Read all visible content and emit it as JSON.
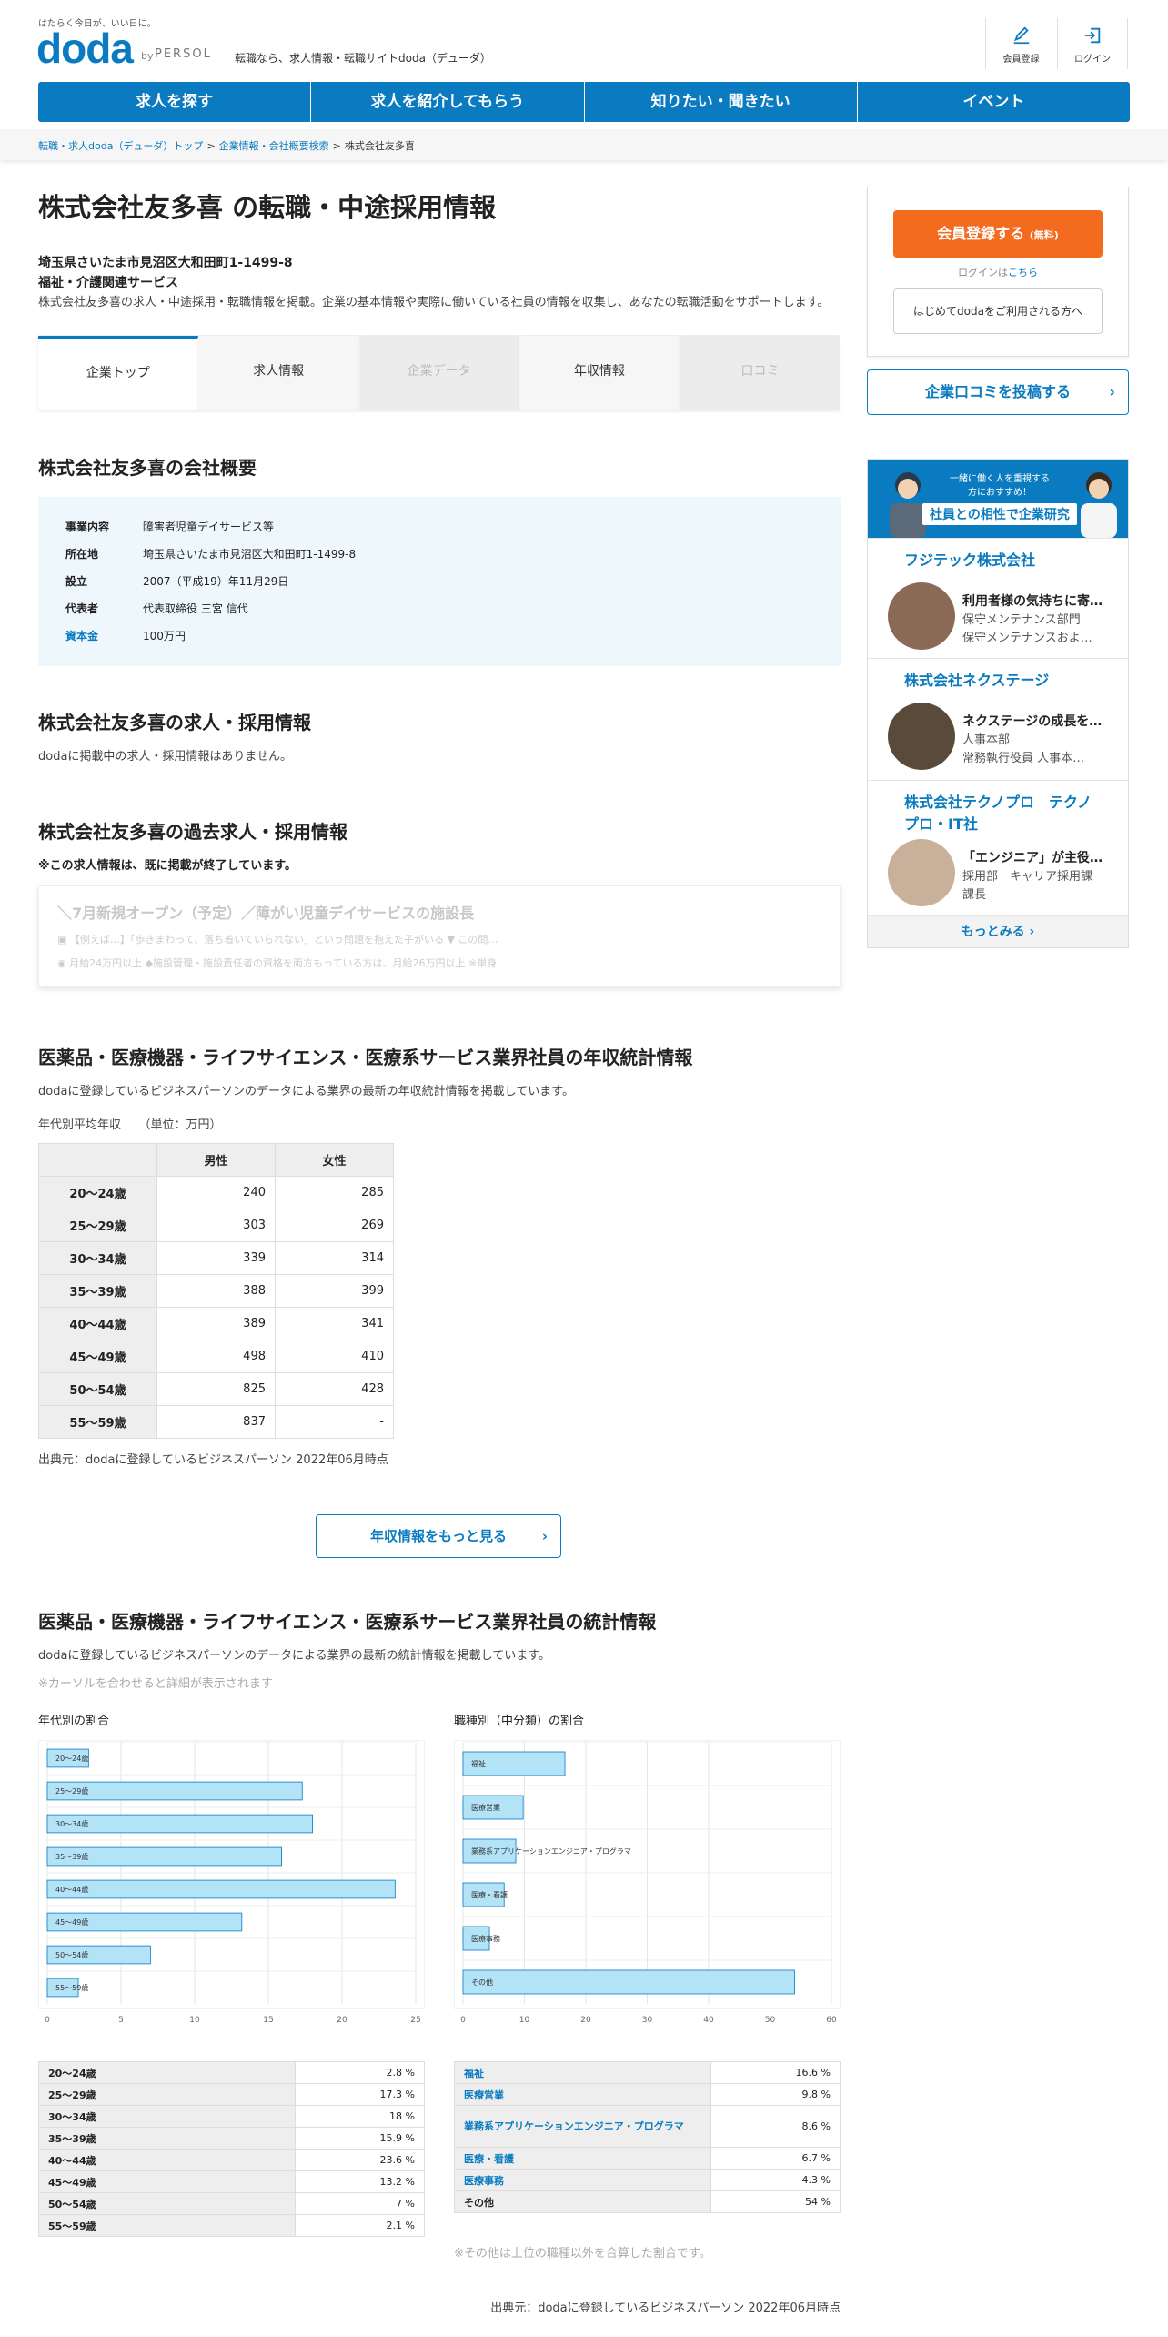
{
  "header": {
    "tagline": "はたらく今日が、いい日に。",
    "logo": "doda",
    "by": "by",
    "persol": "PERSOL",
    "description": "転職なら、求人情報・転職サイトdoda（デューダ）",
    "member_register": "会員登録",
    "login": "ログイン"
  },
  "nav": [
    "求人を探す",
    "求人を紹介してもらう",
    "知りたい・聞きたい",
    "イベント"
  ],
  "breadcrumb": {
    "items": [
      "転職・求人doda（デューダ）トップ",
      "企業情報・会社概要検索"
    ],
    "current": "株式会社友多喜"
  },
  "company": {
    "title": "株式会社友多喜 の転職・中途採用情報",
    "address": "埼玉県さいたま市見沼区大和田町1-1499-8",
    "industry": "福祉・介護関連サービス",
    "description": "株式会社友多喜の求人・中途採用・転職情報を掲載。企業の基本情報や実際に働いている社員の情報を収集し、あなたの転職活動をサポートします。"
  },
  "tabs": [
    "企業トップ",
    "求人情報",
    "企業データ",
    "年収情報",
    "口コミ"
  ],
  "overview": {
    "heading": "株式会社友多喜の会社概要",
    "rows": [
      {
        "k": "事業内容",
        "v": "障害者児童デイサービス等"
      },
      {
        "k": "所在地",
        "v": "埼玉県さいたま市見沼区大和田町1-1499-8"
      },
      {
        "k": "設立",
        "v": "2007（平成19）年11月29日"
      },
      {
        "k": "代表者",
        "v": "代表取締役 三宮 信代"
      },
      {
        "k": "資本金",
        "v": "100万円"
      }
    ]
  },
  "jobs": {
    "heading": "株式会社友多喜の求人・採用情報",
    "note": "dodaに掲載中の求人・採用情報はありません。"
  },
  "past": {
    "heading": "株式会社友多喜の過去求人・採用情報",
    "note": "※この求人情報は、既に掲載が終了しています。",
    "card_title": "＼7月新規オープン（予定）／障がい児童デイサービスの施設長",
    "card_line1": "【例えば…】「歩きまわって、落ち着いていられない」という問題を抱えた子がいる ▼ この問…",
    "card_line2": "月給24万円以上 ◆施設管理・施設責任者の資格を両方もっている方は、月給26万円以上 ※単身…"
  },
  "salary": {
    "heading": "医薬品・医療機器・ライフサイエンス・医療系サービス業界社員の年収統計情報",
    "desc": "dodaに登録しているビジネスパーソンのデータによる業界の最新の年収統計情報を掲載しています。",
    "caption": "年代別平均年収　　（単位：万円）",
    "col_male": "男性",
    "col_female": "女性",
    "rows": [
      {
        "age": "20～24歳",
        "m": "240",
        "f": "285"
      },
      {
        "age": "25～29歳",
        "m": "303",
        "f": "269"
      },
      {
        "age": "30～34歳",
        "m": "339",
        "f": "314"
      },
      {
        "age": "35～39歳",
        "m": "388",
        "f": "399"
      },
      {
        "age": "40～44歳",
        "m": "389",
        "f": "341"
      },
      {
        "age": "45～49歳",
        "m": "498",
        "f": "410"
      },
      {
        "age": "50～54歳",
        "m": "825",
        "f": "428"
      },
      {
        "age": "55～59歳",
        "m": "837",
        "f": "-"
      }
    ],
    "source": "出典元：dodaに登録しているビジネスパーソン 2022年06月時点",
    "more_button": "年収情報をもっと見る"
  },
  "stats": {
    "heading": "医薬品・医療機器・ライフサイエンス・医療系サービス業界社員の統計情報",
    "desc": "dodaに登録しているビジネスパーソンのデータによる業界の最新の統計情報を掲載しています。",
    "hint": "※カーソルを合わせると詳細が表示されます",
    "age_title": "年代別の割合",
    "job_title": "職種別（中分類）の割合",
    "age_table": [
      {
        "k": "20～24歳",
        "v": "2.8 %"
      },
      {
        "k": "25～29歳",
        "v": "17.3 %"
      },
      {
        "k": "30～34歳",
        "v": "18 %"
      },
      {
        "k": "35～39歳",
        "v": "15.9 %"
      },
      {
        "k": "40～44歳",
        "v": "23.6 %"
      },
      {
        "k": "45～49歳",
        "v": "13.2 %"
      },
      {
        "k": "50～54歳",
        "v": "7 %"
      },
      {
        "k": "55～59歳",
        "v": "2.1 %"
      }
    ],
    "job_table": [
      {
        "k": "福祉",
        "v": "16.6 %"
      },
      {
        "k": "医療営業",
        "v": "9.8 %"
      },
      {
        "k": "業務系アプリケーションエンジニア・プログラマ",
        "v": "8.6 %"
      },
      {
        "k": "医療・看護",
        "v": "6.7 %"
      },
      {
        "k": "医療事務",
        "v": "4.3 %"
      },
      {
        "k": "その他",
        "v": "54 %"
      }
    ],
    "other_note": "※その他は上位の職種以外を合算した割合です。",
    "source": "出典元：dodaに登録しているビジネスパーソン 2022年06月時点"
  },
  "chart_data": [
    {
      "type": "bar",
      "orientation": "horizontal",
      "title": "年代別の割合",
      "categories": [
        "20～24歳",
        "25～29歳",
        "30～34歳",
        "35～39歳",
        "40～44歳",
        "45～49歳",
        "50～54歳",
        "55～59歳"
      ],
      "values": [
        2.8,
        17.3,
        18,
        15.9,
        23.6,
        13.2,
        7,
        2.1
      ],
      "xlim": [
        0,
        25
      ],
      "xticks": [
        0,
        5,
        10,
        15,
        20,
        25
      ],
      "grid": true,
      "color": "#b3e3f7"
    },
    {
      "type": "bar",
      "orientation": "horizontal",
      "title": "職種別（中分類）の割合",
      "categories": [
        "福祉",
        "医療営業",
        "業務系アプリケーションエンジニア・プログラマ",
        "医療・看護",
        "医療事務",
        "その他"
      ],
      "values": [
        16.6,
        9.8,
        8.6,
        6.7,
        4.3,
        54
      ],
      "xlim": [
        0,
        60
      ],
      "xticks": [
        0,
        10,
        20,
        30,
        40,
        50,
        60
      ],
      "grid": true,
      "color": "#b3e3f7"
    }
  ],
  "sidebar": {
    "register_button": "会員登録する",
    "register_free": "(無料)",
    "login_prefix": "ログインは",
    "login_link": "こちら",
    "first_time": "はじめてdodaをご利用される方へ",
    "kuchikomi_button": "企業口コミを投稿する",
    "banner_small": "一緒に働く人を重視する方におすすめ！",
    "banner_title": "社員との相性で企業研究",
    "companies": [
      {
        "name": "フジテック株式会社",
        "title": "利用者様の気持ちに寄…",
        "dept1": "保守メンテナンス部門",
        "dept2": "保守メンテナンスおよ…"
      },
      {
        "name": "株式会社ネクステージ",
        "title": "ネクステージの成長を…",
        "dept1": "人事本部",
        "dept2": "常務執行役員 人事本…"
      },
      {
        "name": "株式会社テクノプロ　テクノプロ・IT社",
        "title": "「エンジニア」が主役…",
        "dept1": "採用部　キャリア採用課",
        "dept2": "課長"
      }
    ],
    "more": "もっとみる"
  },
  "colors": {
    "brand": "#0a7bc0",
    "accent": "#f26b1f",
    "bar": "#b3e3f7"
  }
}
